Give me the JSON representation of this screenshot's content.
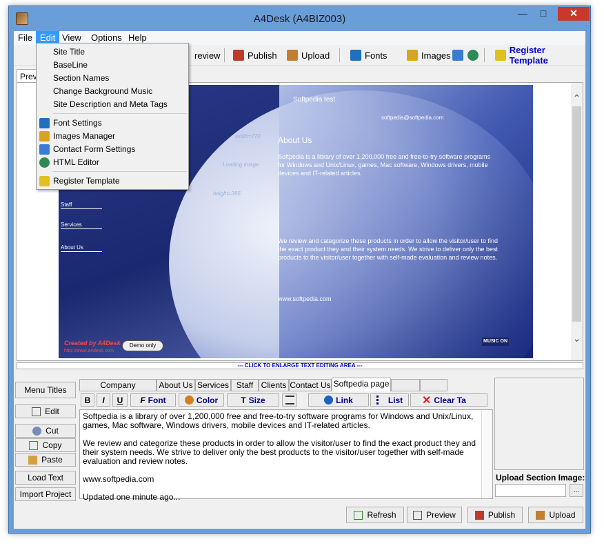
{
  "window": {
    "title": "A4Desk (A4BIZ003)"
  },
  "menubar": {
    "items": [
      "File",
      "Edit",
      "View",
      "Options",
      "Help"
    ],
    "active": "Edit"
  },
  "toolbar": {
    "preview": "review",
    "publish": "Publish",
    "upload": "Upload",
    "fonts": "Fonts",
    "images": "Images",
    "register": "Register Template"
  },
  "edit_menu": {
    "items": [
      "Site Title",
      "BaseLine",
      "Section Names",
      "Change Background Music",
      "Site Description and Meta Tags",
      "Font Settings",
      "Images Manager",
      "Contact Form Settings",
      "HTML Editor",
      "Register Template"
    ]
  },
  "preview": {
    "tab": "Previ",
    "site": {
      "title": "Softpedia test",
      "email": "softpedia@softpedia.com",
      "about_heading": "About Us",
      "p1": "Softpedia is a library of over 1,200,000 free and free-to-try software programs for Windows and Unix/Linux, games, Mac software, Windows drivers, mobile devices and IT-related articles.",
      "p2": "We review and categorize these products in order to allow the visitor/user to find the exact product they and their system needs. We strive to deliver only the best products to the visitor/user together with self-made evaluation and review notes.",
      "url": "www.softpedia.com",
      "nav": [
        "Staff",
        "Services",
        "About Us"
      ],
      "created": "Created by A4Desk",
      "created_url": "http://www.a4desk.com",
      "demo": "Demo only",
      "music": "MUSIC ON",
      "placeholders": [
        "width=770",
        "Loading image",
        "height=395"
      ]
    }
  },
  "enlarge": "--- CLICK TO ENLARGE TEXT EDITING AREA ---",
  "left_buttons": [
    "Menu Titles",
    "Edit",
    "Cut",
    "Copy",
    "Paste",
    "Load Text",
    "Import Project"
  ],
  "tabs": [
    "Company Information",
    "About Us",
    "Services",
    "Staff",
    "Clients",
    "Contact Us",
    "Softpedia page"
  ],
  "format": {
    "bold": "B",
    "italic": "I",
    "underline": "U",
    "font": "Font",
    "color": "Color",
    "size": "Size",
    "link": "Link",
    "list": "List",
    "clear": "Clear Ta"
  },
  "editor": {
    "p1": "Softpedia is a library of over 1,200,000 free and free-to-try software programs for Windows and Unix/Linux, games, Mac software, Windows drivers, mobile devices and IT-related articles.",
    "p2": "We review and categorize these products in order to allow the visitor/user to find the exact product they and their system needs. We strive to deliver only the best products to the visitor/user together with self-made evaluation and review notes.",
    "p3": "www.softpedia.com",
    "p4": "Updated one minute ago..."
  },
  "upload_section": {
    "label": "Upload Section Image:",
    "browse": "..."
  },
  "bottom": {
    "refresh": "Refresh",
    "preview": "Preview",
    "publish": "Publish",
    "upload": "Upload"
  }
}
